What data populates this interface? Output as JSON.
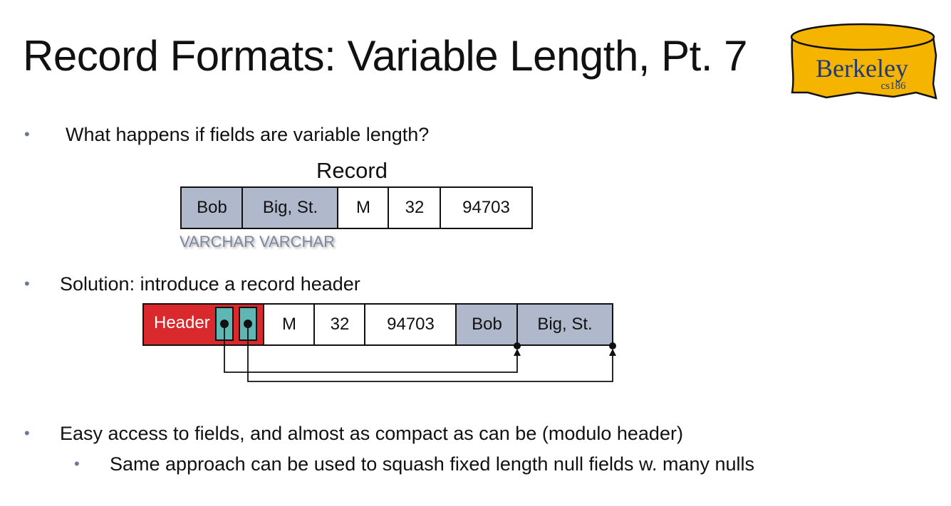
{
  "title": "Record Formats: Variable Length, Pt. 7",
  "logo": {
    "name": "Berkeley",
    "course": "cs186",
    "fill": "#f4b400"
  },
  "bullets": [
    "What happens if fields are variable length?",
    "Solution: introduce a record header",
    "Easy access to fields, and almost as compact as can be (modulo header)"
  ],
  "sub_bullets": [
    "Same approach can be used to squash fixed length null fields w. many nulls"
  ],
  "bullet_marker": "•",
  "record": {
    "label": "Record",
    "fields": [
      "Bob",
      "Big, St.",
      "M",
      "32",
      "94703"
    ],
    "type_labels": "VARCHAR VARCHAR"
  },
  "header_record": {
    "header_label": "Header",
    "fields": [
      "M",
      "32",
      "94703",
      "Bob",
      "Big, St."
    ]
  },
  "colors": {
    "varchar_fill": "#b0b8cc",
    "header_fill": "#d9292c",
    "pointer_slot_fill": "#5fb7b3",
    "bullet": "#6a7a95"
  }
}
